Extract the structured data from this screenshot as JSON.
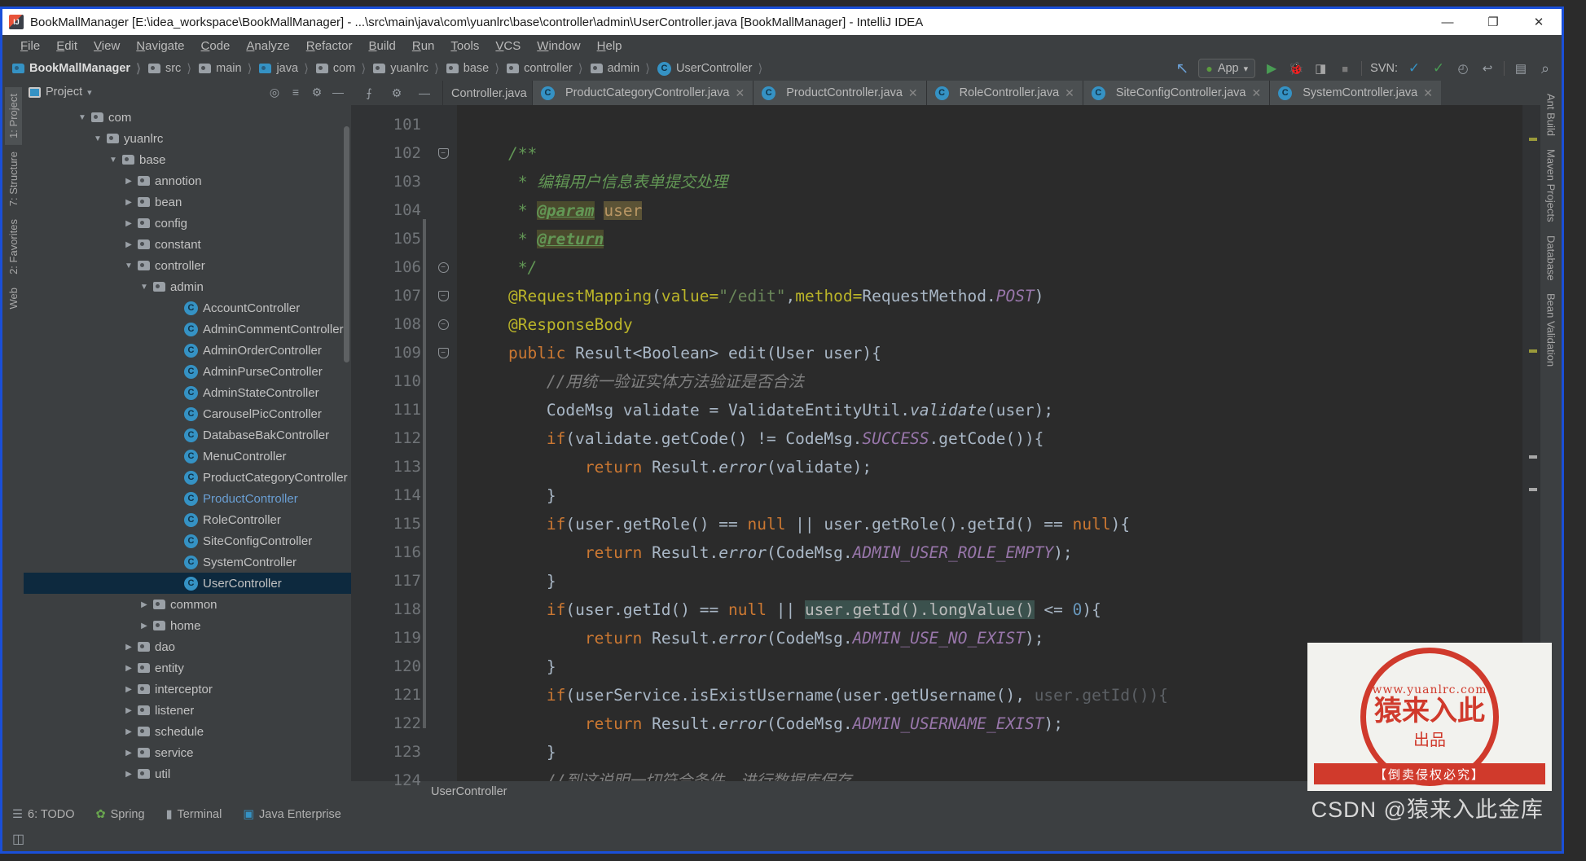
{
  "window": {
    "title": "BookMallManager [E:\\idea_workspace\\BookMallManager] - ...\\src\\main\\java\\com\\yuanlrc\\base\\controller\\admin\\UserController.java [BookMallManager] - IntelliJ IDEA",
    "minimize": "—",
    "maximize": "❐",
    "close": "✕"
  },
  "menu": [
    "File",
    "Edit",
    "View",
    "Navigate",
    "Code",
    "Analyze",
    "Refactor",
    "Build",
    "Run",
    "Tools",
    "VCS",
    "Window",
    "Help"
  ],
  "breadcrumb": [
    {
      "label": "BookMallManager",
      "icon": "folder-blue-icon"
    },
    {
      "label": "src",
      "icon": "folder-icon"
    },
    {
      "label": "main",
      "icon": "folder-icon"
    },
    {
      "label": "java",
      "icon": "folder-blue-icon"
    },
    {
      "label": "com",
      "icon": "folder-icon"
    },
    {
      "label": "yuanlrc",
      "icon": "folder-icon"
    },
    {
      "label": "base",
      "icon": "folder-icon"
    },
    {
      "label": "controller",
      "icon": "folder-icon"
    },
    {
      "label": "admin",
      "icon": "folder-icon"
    },
    {
      "label": "UserController",
      "icon": "class-icon"
    }
  ],
  "toolbar": {
    "back_arrow": "↖",
    "run_config": "App",
    "run_config_caret": "▾",
    "run": "▶",
    "debug": "🐞",
    "run_coverage": "◨",
    "stop": "■",
    "svn_label": "SVN:",
    "svn_update": "✓",
    "svn_commit": "✓",
    "svn_history": "◴",
    "svn_revert": "↩",
    "project_structure": "▤",
    "search": "⌕"
  },
  "left_strips": [
    {
      "label": "1: Project",
      "active": true
    },
    {
      "label": "7: Structure",
      "active": false
    },
    {
      "label": "2: Favorites",
      "active": false
    },
    {
      "label": "Web",
      "active": false
    }
  ],
  "right_strips": [
    "Ant Build",
    "Maven Projects",
    "Database",
    "Bean Validation"
  ],
  "project_panel": {
    "title": "Project",
    "caret": "▾",
    "icons": [
      "target-icon",
      "collapse-all-icon",
      "settings-icon",
      "hide-icon"
    ],
    "tree": [
      {
        "label": "com",
        "indent": 3,
        "arrow": "▼",
        "icon": "folder-icon"
      },
      {
        "label": "yuanlrc",
        "indent": 4,
        "arrow": "▼",
        "icon": "folder-icon"
      },
      {
        "label": "base",
        "indent": 5,
        "arrow": "▼",
        "icon": "folder-icon"
      },
      {
        "label": "annotion",
        "indent": 6,
        "arrow": "▶",
        "icon": "folder-icon"
      },
      {
        "label": "bean",
        "indent": 6,
        "arrow": "▶",
        "icon": "folder-icon"
      },
      {
        "label": "config",
        "indent": 6,
        "arrow": "▶",
        "icon": "folder-icon"
      },
      {
        "label": "constant",
        "indent": 6,
        "arrow": "▶",
        "icon": "folder-icon"
      },
      {
        "label": "controller",
        "indent": 6,
        "arrow": "▼",
        "icon": "folder-icon"
      },
      {
        "label": "admin",
        "indent": 7,
        "arrow": "▼",
        "icon": "folder-icon"
      },
      {
        "label": "AccountController",
        "indent": 9,
        "arrow": "",
        "icon": "class-icon"
      },
      {
        "label": "AdminCommentController",
        "indent": 9,
        "arrow": "",
        "icon": "class-icon"
      },
      {
        "label": "AdminOrderController",
        "indent": 9,
        "arrow": "",
        "icon": "class-icon"
      },
      {
        "label": "AdminPurseController",
        "indent": 9,
        "arrow": "",
        "icon": "class-icon"
      },
      {
        "label": "AdminStateController",
        "indent": 9,
        "arrow": "",
        "icon": "class-icon"
      },
      {
        "label": "CarouselPicController",
        "indent": 9,
        "arrow": "",
        "icon": "class-icon"
      },
      {
        "label": "DatabaseBakController",
        "indent": 9,
        "arrow": "",
        "icon": "class-icon"
      },
      {
        "label": "MenuController",
        "indent": 9,
        "arrow": "",
        "icon": "class-icon"
      },
      {
        "label": "ProductCategoryController",
        "indent": 9,
        "arrow": "",
        "icon": "class-icon"
      },
      {
        "label": "ProductController",
        "indent": 9,
        "arrow": "",
        "icon": "class-icon",
        "highlighted_text": true
      },
      {
        "label": "RoleController",
        "indent": 9,
        "arrow": "",
        "icon": "class-icon"
      },
      {
        "label": "SiteConfigController",
        "indent": 9,
        "arrow": "",
        "icon": "class-icon"
      },
      {
        "label": "SystemController",
        "indent": 9,
        "arrow": "",
        "icon": "class-icon"
      },
      {
        "label": "UserController",
        "indent": 9,
        "arrow": "",
        "icon": "class-icon",
        "selected": true
      },
      {
        "label": "common",
        "indent": 7,
        "arrow": "▶",
        "icon": "folder-icon"
      },
      {
        "label": "home",
        "indent": 7,
        "arrow": "▶",
        "icon": "folder-icon"
      },
      {
        "label": "dao",
        "indent": 6,
        "arrow": "▶",
        "icon": "folder-icon"
      },
      {
        "label": "entity",
        "indent": 6,
        "arrow": "▶",
        "icon": "folder-icon"
      },
      {
        "label": "interceptor",
        "indent": 6,
        "arrow": "▶",
        "icon": "folder-icon"
      },
      {
        "label": "listener",
        "indent": 6,
        "arrow": "▶",
        "icon": "folder-icon"
      },
      {
        "label": "schedule",
        "indent": 6,
        "arrow": "▶",
        "icon": "folder-icon"
      },
      {
        "label": "service",
        "indent": 6,
        "arrow": "▶",
        "icon": "folder-icon"
      },
      {
        "label": "util",
        "indent": 6,
        "arrow": "▶",
        "icon": "folder-icon"
      }
    ]
  },
  "editor_tabs": [
    {
      "label": "\u0001Controller.java",
      "partial": true,
      "active": false
    },
    {
      "label": "ProductCategoryController.java",
      "active": false
    },
    {
      "label": "ProductController.java",
      "active": false
    },
    {
      "label": "RoleController.java",
      "active": false
    },
    {
      "label": "SiteConfigController.java",
      "active": false
    },
    {
      "label": "SystemController.java",
      "active": false
    }
  ],
  "editor_tab_close": "✕",
  "editor_tools": {
    "collapse": "⨍",
    "settings": "⚙",
    "hide": "—"
  },
  "code": {
    "first_line": 101,
    "lines": [
      {
        "n": 101,
        "fold": "",
        "tokens": []
      },
      {
        "n": 102,
        "fold": "down",
        "tokens": [
          {
            "t": "    ",
            "c": "ident"
          },
          {
            "t": "/**",
            "c": "cmt"
          }
        ]
      },
      {
        "n": 103,
        "fold": "",
        "tokens": [
          {
            "t": "     * ",
            "c": "cmt"
          },
          {
            "t": "编辑用户信息表单提交处理",
            "c": "cmt"
          }
        ]
      },
      {
        "n": 104,
        "fold": "",
        "tokens": [
          {
            "t": "     * ",
            "c": "cmt"
          },
          {
            "t": "@param",
            "c": "tag"
          },
          {
            "t": " ",
            "c": "cmt"
          },
          {
            "t": "user",
            "c": "pval"
          }
        ]
      },
      {
        "n": 105,
        "fold": "",
        "tokens": [
          {
            "t": "     * ",
            "c": "cmt"
          },
          {
            "t": "@return",
            "c": "tag"
          }
        ]
      },
      {
        "n": 106,
        "fold": "round",
        "tokens": [
          {
            "t": "     */",
            "c": "cmt"
          }
        ]
      },
      {
        "n": 107,
        "fold": "down",
        "tokens": [
          {
            "t": "    ",
            "c": "ident"
          },
          {
            "t": "@RequestMapping",
            "c": "anno"
          },
          {
            "t": "(",
            "c": "ident"
          },
          {
            "t": "value=",
            "c": "anno"
          },
          {
            "t": "\"/edit\"",
            "c": "str"
          },
          {
            "t": ",",
            "c": "ident"
          },
          {
            "t": "method=",
            "c": "anno"
          },
          {
            "t": "RequestMethod.",
            "c": "ident"
          },
          {
            "t": "POST",
            "c": "stat"
          },
          {
            "t": ")",
            "c": "ident"
          }
        ]
      },
      {
        "n": 108,
        "fold": "round",
        "tokens": [
          {
            "t": "    ",
            "c": "ident"
          },
          {
            "t": "@ResponseBody",
            "c": "anno"
          }
        ]
      },
      {
        "n": 109,
        "fold": "down",
        "tokens": [
          {
            "t": "    ",
            "c": "ident"
          },
          {
            "t": "public",
            "c": "kw"
          },
          {
            "t": " Result<Boolean> ",
            "c": "ident"
          },
          {
            "t": "edit",
            "c": "ident"
          },
          {
            "t": "(User user){",
            "c": "ident"
          }
        ]
      },
      {
        "n": 110,
        "fold": "",
        "tokens": [
          {
            "t": "        ",
            "c": "ident"
          },
          {
            "t": "//用统一验证实体方法验证是否合法",
            "c": "cmt2"
          }
        ]
      },
      {
        "n": 111,
        "fold": "",
        "tokens": [
          {
            "t": "        CodeMsg validate = ValidateEntityUtil.",
            "c": "ident"
          },
          {
            "t": "validate",
            "c": "meth"
          },
          {
            "t": "(user);",
            "c": "ident"
          }
        ]
      },
      {
        "n": 112,
        "fold": "",
        "tokens": [
          {
            "t": "        ",
            "c": "ident"
          },
          {
            "t": "if",
            "c": "kw"
          },
          {
            "t": "(validate.getCode() != CodeMsg.",
            "c": "ident"
          },
          {
            "t": "SUCCESS",
            "c": "stat"
          },
          {
            "t": ".getCode()){",
            "c": "ident"
          }
        ]
      },
      {
        "n": 113,
        "fold": "",
        "tokens": [
          {
            "t": "            ",
            "c": "ident"
          },
          {
            "t": "return",
            "c": "kw"
          },
          {
            "t": " Result.",
            "c": "ident"
          },
          {
            "t": "error",
            "c": "meth"
          },
          {
            "t": "(validate);",
            "c": "ident"
          }
        ]
      },
      {
        "n": 114,
        "fold": "",
        "tokens": [
          {
            "t": "        }",
            "c": "ident"
          }
        ]
      },
      {
        "n": 115,
        "fold": "",
        "tokens": [
          {
            "t": "        ",
            "c": "ident"
          },
          {
            "t": "if",
            "c": "kw"
          },
          {
            "t": "(user.getRole() == ",
            "c": "ident"
          },
          {
            "t": "null",
            "c": "kw"
          },
          {
            "t": " || user.getRole().getId() == ",
            "c": "ident"
          },
          {
            "t": "null",
            "c": "kw"
          },
          {
            "t": "){",
            "c": "ident"
          }
        ]
      },
      {
        "n": 116,
        "fold": "",
        "tokens": [
          {
            "t": "            ",
            "c": "ident"
          },
          {
            "t": "return",
            "c": "kw"
          },
          {
            "t": " Result.",
            "c": "ident"
          },
          {
            "t": "error",
            "c": "meth"
          },
          {
            "t": "(CodeMsg.",
            "c": "ident"
          },
          {
            "t": "ADMIN_USER_ROLE_EMPTY",
            "c": "stat"
          },
          {
            "t": ");",
            "c": "ident"
          }
        ]
      },
      {
        "n": 117,
        "fold": "",
        "tokens": [
          {
            "t": "        }",
            "c": "ident"
          }
        ]
      },
      {
        "n": 118,
        "fold": "",
        "tokens": [
          {
            "t": "        ",
            "c": "ident"
          },
          {
            "t": "if",
            "c": "kw"
          },
          {
            "t": "(user.getId() == ",
            "c": "ident"
          },
          {
            "t": "null",
            "c": "kw"
          },
          {
            "t": " || ",
            "c": "ident"
          },
          {
            "t": "user.getId().longValue()",
            "c": "hl"
          },
          {
            "t": " <= ",
            "c": "ident"
          },
          {
            "t": "0",
            "c": "num"
          },
          {
            "t": "){",
            "c": "ident"
          }
        ]
      },
      {
        "n": 119,
        "fold": "",
        "tokens": [
          {
            "t": "            ",
            "c": "ident"
          },
          {
            "t": "return",
            "c": "kw"
          },
          {
            "t": " Result.",
            "c": "ident"
          },
          {
            "t": "error",
            "c": "meth"
          },
          {
            "t": "(CodeMsg.",
            "c": "ident"
          },
          {
            "t": "ADMIN_USE_NO_EXIST",
            "c": "stat"
          },
          {
            "t": ");",
            "c": "ident"
          }
        ]
      },
      {
        "n": 120,
        "fold": "",
        "tokens": [
          {
            "t": "        }",
            "c": "ident"
          }
        ]
      },
      {
        "n": 121,
        "fold": "",
        "tokens": [
          {
            "t": "        ",
            "c": "ident"
          },
          {
            "t": "if",
            "c": "kw"
          },
          {
            "t": "(userService.",
            "c": "ident"
          },
          {
            "t": "isExistUsername",
            "c": "ident"
          },
          {
            "t": "(user.getUsername(), ",
            "c": "ident"
          },
          {
            "t": "user.getId()){",
            "c": "dim"
          }
        ]
      },
      {
        "n": 122,
        "fold": "",
        "tokens": [
          {
            "t": "            ",
            "c": "ident"
          },
          {
            "t": "return",
            "c": "kw"
          },
          {
            "t": " Result.",
            "c": "ident"
          },
          {
            "t": "error",
            "c": "meth"
          },
          {
            "t": "(CodeMsg.",
            "c": "ident"
          },
          {
            "t": "ADMIN_USERNAME_EXIST",
            "c": "stat"
          },
          {
            "t": ");",
            "c": "ident"
          }
        ]
      },
      {
        "n": 123,
        "fold": "",
        "tokens": [
          {
            "t": "        }",
            "c": "ident"
          }
        ]
      },
      {
        "n": 124,
        "fold": "",
        "tokens": [
          {
            "t": "        ",
            "c": "ident"
          },
          {
            "t": "//到这说明一切符合条件，进行数据库保存",
            "c": "cmt2"
          }
        ]
      }
    ]
  },
  "editor_breadcrumb": "UserController",
  "statusbar": {
    "todo": "6: TODO",
    "spring": "Spring",
    "terminal": "Terminal",
    "java_enterprise": "Java Enterprise"
  },
  "watermark": {
    "site": "www.yuanlrc.com",
    "line1": "猿来入此",
    "line2": "出品",
    "band": "【倒卖侵权必究】",
    "csdn": "CSDN @猿来入此金库"
  },
  "colors": {
    "window_border": "#1a4fd8",
    "chrome": "#3c3f41",
    "editor_bg": "#2b2b2b",
    "gutter_bg": "#313335",
    "selection": "#0d293e",
    "accent_blue": "#3592c4",
    "stamp_red": "#d03a2c"
  }
}
